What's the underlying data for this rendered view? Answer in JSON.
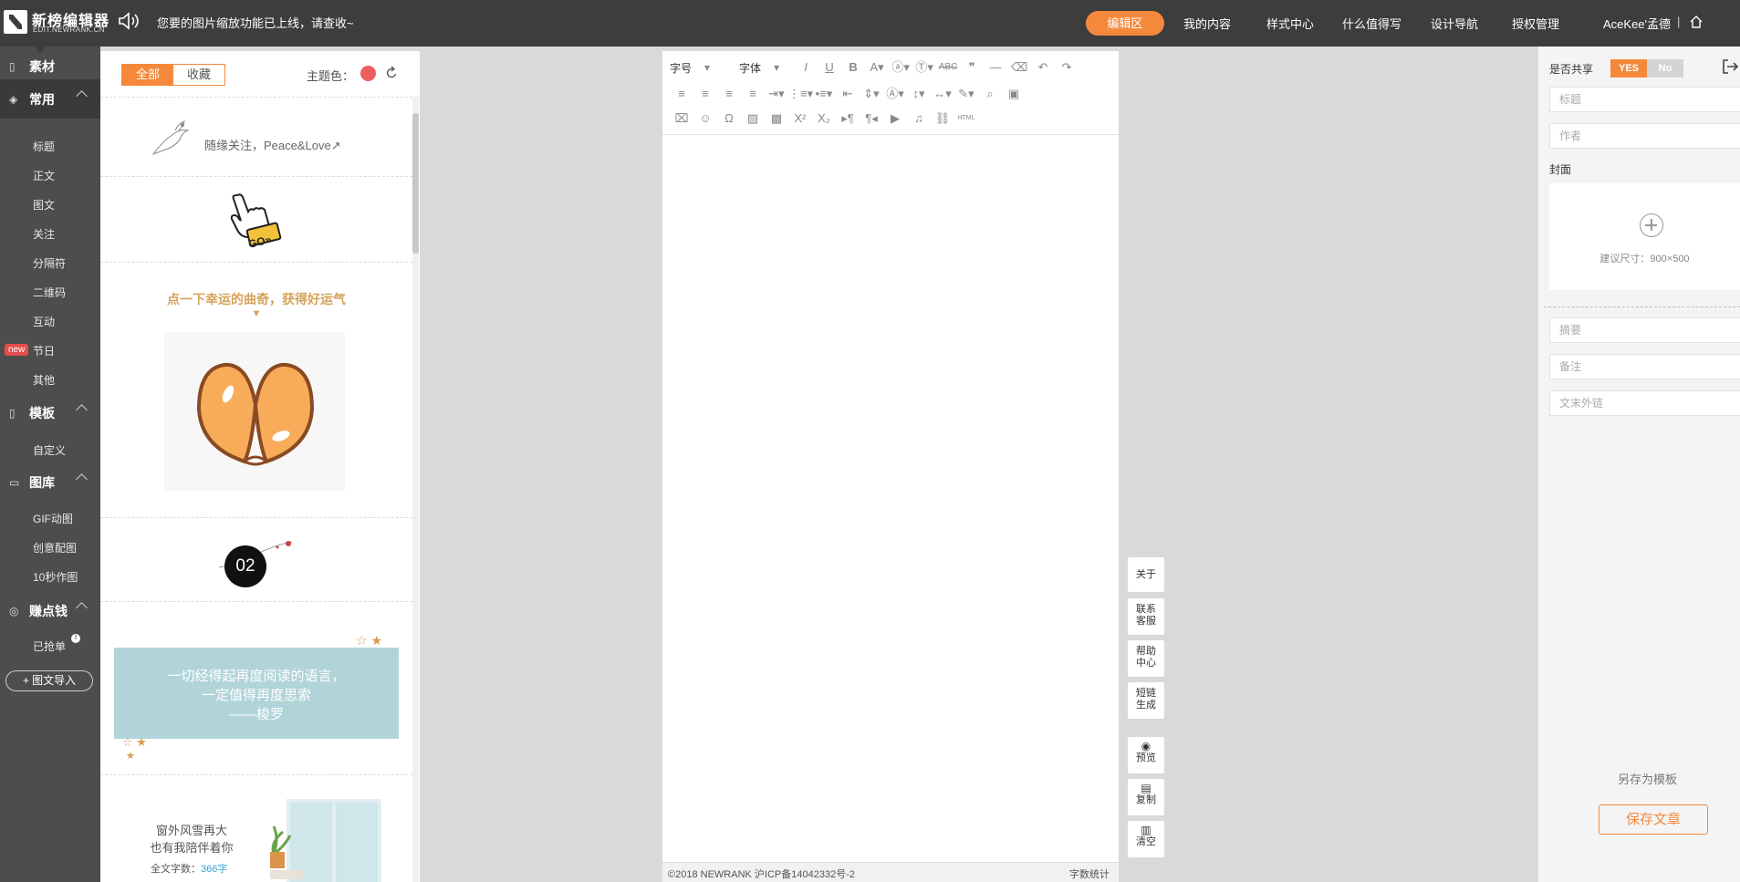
{
  "header": {
    "logo_title": "新榜编辑器",
    "logo_sub": "EDIT.NEWRANK.CN",
    "notice": "您要的图片缩放功能已上线，请查收~",
    "nav": [
      "编辑区",
      "我的内容",
      "样式中心",
      "什么值得写",
      "设计导航",
      "授权管理"
    ],
    "user": "AceKee'孟德",
    "separator": "|"
  },
  "sidebar": {
    "material": "素材",
    "common": {
      "label": "常用",
      "items": [
        "标题",
        "正文",
        "图文",
        "关注",
        "分隔符",
        "二维码",
        "互动",
        "节日",
        "其他"
      ]
    },
    "template": {
      "label": "模板",
      "badge": "new",
      "items": [
        "自定义"
      ]
    },
    "gallery": {
      "label": "图库",
      "items": [
        "GIF动图",
        "创意配图",
        "10秒作图"
      ]
    },
    "earn": {
      "label": "赚点钱",
      "items": [
        "已抢单"
      ],
      "badge": "!"
    },
    "import": "图文导入"
  },
  "material": {
    "tabs": [
      "全部",
      "收藏"
    ],
    "theme_label": "主题色：",
    "theme_color": "#ed5e5e",
    "card1_text": "随缘关注，Peace&Love↗",
    "card2_badge": "GO»",
    "card3_title": "点一下幸运的曲奇，获得好运气",
    "card3_arrow": "▼",
    "card4_number": "02",
    "quote": {
      "line1": "一切经得起再度阅读的语言，",
      "line2": "一定值得再度思索",
      "line3": "——梭罗"
    },
    "card6": {
      "line1": "窗外风雪再大",
      "line2": "也有我陪伴着你",
      "count_label": "全文字数：",
      "count_value": "366字"
    }
  },
  "editor": {
    "font_size": "字号",
    "font_family": "字体",
    "footer_left": "©2018 NEWRANK 沪ICP备14042332号-2",
    "footer_right": "字数统计",
    "html_label": "HTML"
  },
  "float": {
    "about": "关于",
    "contact": [
      "联系",
      "客服"
    ],
    "help": [
      "帮助",
      "中心"
    ],
    "shortlink": [
      "短链",
      "生成"
    ],
    "preview": "预览",
    "copy": "复制",
    "clear": "清空"
  },
  "right": {
    "share_label": "是否共享",
    "yes": "YES",
    "no": "No",
    "title_ph": "标题",
    "author_ph": "作者",
    "cover_label": "封面",
    "cover_hint": "建议尺寸：900×500",
    "summary_ph": "摘要",
    "note_ph": "备注",
    "link_ph": "文末外链",
    "save_template": "另存为模板",
    "save_article": "保存文章"
  }
}
